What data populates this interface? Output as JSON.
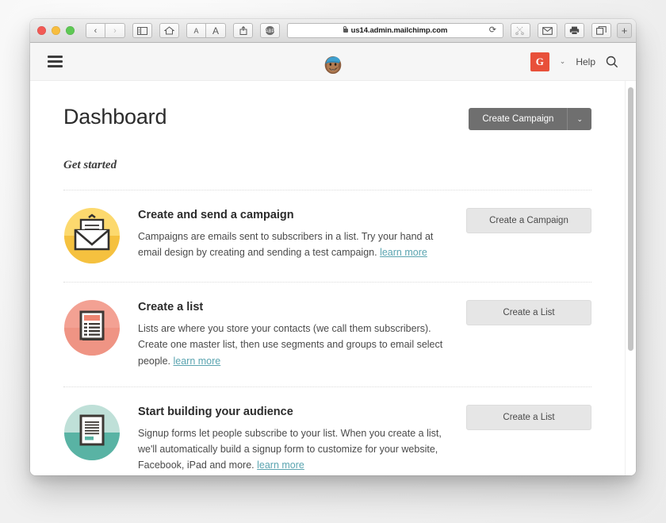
{
  "browser": {
    "traffic_lights": [
      "close",
      "minimize",
      "maximize"
    ],
    "back_label": "‹",
    "forward_label": "›",
    "sidebar_label": "▣",
    "home_label": "⌂",
    "text_small_label": "A",
    "text_large_label": "A",
    "share_label": "↥",
    "adblock_label": "ABP",
    "url": "us14.admin.mailchimp.com",
    "reload_label": "⟳",
    "cut_label": "✂",
    "mail_label": "✉",
    "print_label": "⎙",
    "tabs_label": "❐",
    "new_tab_label": "+"
  },
  "header": {
    "menu_label": "menu",
    "logo_label": "Freddie the Mailchimp mascot",
    "avatar_initial": "G",
    "account_chevron": "⌄",
    "help_label": "Help",
    "search_label": "search"
  },
  "main": {
    "page_title": "Dashboard",
    "primary_button": "Create Campaign",
    "primary_button_chevron": "⌄",
    "section_title": "Get started"
  },
  "cards": [
    {
      "icon": "envelope-icon",
      "icon_color": "#f6c243",
      "title": "Create and send a campaign",
      "description": "Campaigns are emails sent to subscribers in a list. Try your hand at email design by creating and sending a test campaign.",
      "link_text": "learn more",
      "button_label": "Create a Campaign"
    },
    {
      "icon": "list-document-icon",
      "icon_color": "#ef9484",
      "title": "Create a list",
      "description": "Lists are where you store your contacts (we call them subscribers). Create one master list, then use segments and groups to email select people.",
      "link_text": "learn more",
      "button_label": "Create a List"
    },
    {
      "icon": "signup-form-icon",
      "icon_color": "#59b3a4",
      "title": "Start building your audience",
      "description": "Signup forms let people subscribe to your list. When you create a list, we'll automatically build a signup form to customize for your website, Facebook, iPad and more.",
      "link_text": "learn more",
      "button_label": "Create a List"
    }
  ],
  "colors": {
    "accent_red": "#e8503a",
    "link_teal": "#5aa4b0",
    "primary_button_bg": "#6f6f6f"
  }
}
